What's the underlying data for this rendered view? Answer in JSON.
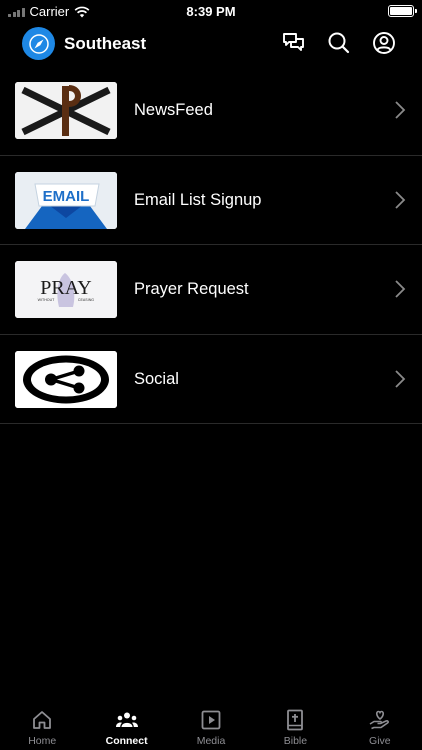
{
  "status_bar": {
    "carrier": "Carrier",
    "time": "8:39 PM"
  },
  "header": {
    "title": "Southeast"
  },
  "list": [
    {
      "label": "NewsFeed"
    },
    {
      "label": "Email List Signup",
      "thumb_text": "EMAIL"
    },
    {
      "label": "Prayer Request",
      "thumb_text": "PRAY",
      "thumb_subtext_left": "WITHOUT",
      "thumb_subtext_right": "CEASING"
    },
    {
      "label": "Social"
    }
  ],
  "tabs": [
    {
      "label": "Home",
      "icon": "home-icon",
      "active": false
    },
    {
      "label": "Connect",
      "icon": "people-icon",
      "active": true
    },
    {
      "label": "Media",
      "icon": "play-icon",
      "active": false
    },
    {
      "label": "Bible",
      "icon": "bible-icon",
      "active": false
    },
    {
      "label": "Give",
      "icon": "give-icon",
      "active": false
    }
  ],
  "colors": {
    "accent": "#1e88e5",
    "background": "#000000",
    "inactive": "#8e8e93"
  }
}
